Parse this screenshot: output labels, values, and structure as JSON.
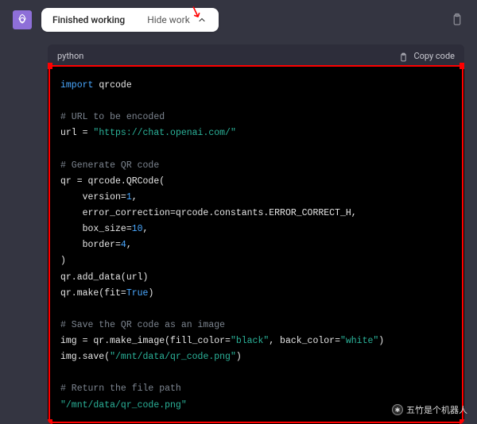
{
  "header": {
    "status_label": "Finished working",
    "hide_label": "Hide work"
  },
  "code": {
    "language": "python",
    "copy_label": "Copy code",
    "tokens": {
      "kw_import": "import",
      "mod_qrcode": " qrcode",
      "c_url": "# URL to be encoded",
      "l_url_a": "url = ",
      "s_url": "\"https://chat.openai.com/\"",
      "c_gen": "# Generate QR code",
      "l_qr": "qr = qrcode.QRCode(",
      "l_ver_a": "    version=",
      "n_ver": "1",
      "comma": ",",
      "l_err": "    error_correction=qrcode.constants.ERROR_CORRECT_H,",
      "l_box_a": "    box_size=",
      "n_box": "10",
      "l_bor_a": "    border=",
      "n_bor": "4",
      "l_close": ")",
      "l_add": "qr.add_data(url)",
      "l_make_a": "qr.make(fit=",
      "b_true": "True",
      "l_make_b": ")",
      "c_save": "# Save the QR code as an image",
      "l_img_a": "img = qr.make_image(fill_color=",
      "s_black": "\"black\"",
      "l_img_b": ", back_color=",
      "s_white": "\"white\"",
      "l_img_c": ")",
      "l_save_a": "img.save(",
      "s_path": "\"/mnt/data/qr_code.png\"",
      "l_save_b": ")",
      "c_ret": "# Return the file path",
      "s_path2": "\"/mnt/data/qr_code.png\""
    }
  },
  "watermark": {
    "text": "五竹是个机器人"
  }
}
